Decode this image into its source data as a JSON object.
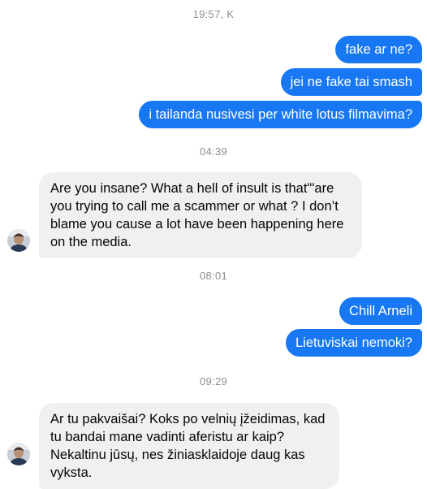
{
  "timestamps": [
    "19:57, K",
    "04:39",
    "08:01",
    "09:29"
  ],
  "messages": [
    {
      "from": "me",
      "text": "fake ar ne?"
    },
    {
      "from": "me",
      "text": "jei ne fake tai smash"
    },
    {
      "from": "me",
      "text": "i tailanda nusivesi per white lotus filmavima?"
    },
    {
      "from": "them",
      "text": "Are you insane? What a hell of insult is that\"'are you trying to call me a scammer or what ? I don’t blame you cause a lot have been happening here on the media."
    },
    {
      "from": "me",
      "text": "Chill Arneli"
    },
    {
      "from": "me",
      "text": "Lietuviskai nemoki?"
    },
    {
      "from": "them",
      "text": "Ar tu pakvaišai? Koks po velnių įžeidimas, kad tu bandai mane vadinti aferistu ar kaip? Nekaltinu jūsų, nes žiniasklaidoje daug kas vyksta."
    }
  ],
  "colors": {
    "outgoing_bubble": "#1877f2",
    "incoming_bubble": "#f0f0f0",
    "timestamp_text": "#8a8d91"
  },
  "icons": {
    "contact_avatar": "contact-avatar-icon"
  }
}
